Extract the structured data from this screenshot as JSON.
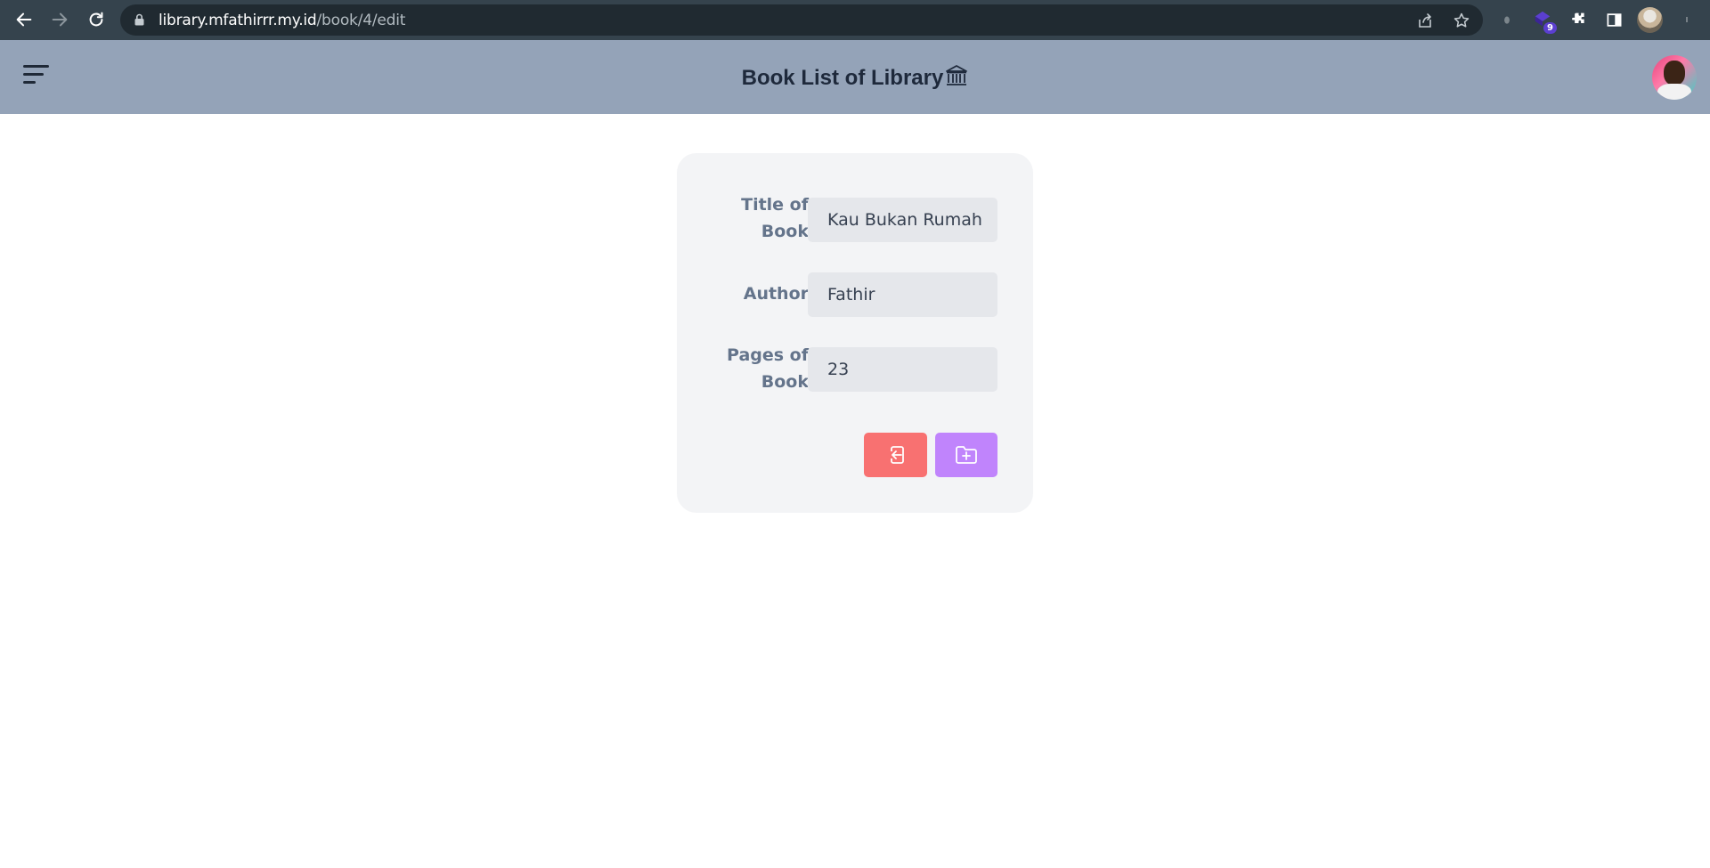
{
  "browser": {
    "url_host": "library.mfathirrr.my.id",
    "url_path": "/book/4/edit",
    "extension_badge": "9"
  },
  "header": {
    "title": "Book List of Library",
    "title_icon": "bank-icon"
  },
  "form": {
    "fields": [
      {
        "label": "Title of Book",
        "value": "Kau Bukan Rumah"
      },
      {
        "label": "Author",
        "value": "Fathir"
      },
      {
        "label": "Pages of Book",
        "value": "23"
      }
    ],
    "back_button_icon": "exit-icon",
    "save_button_icon": "folder-plus-icon"
  },
  "colors": {
    "header_bg": "#94a3b8",
    "card_bg": "#f3f4f6",
    "back_button": "#f87171",
    "save_button": "#c084fc"
  }
}
